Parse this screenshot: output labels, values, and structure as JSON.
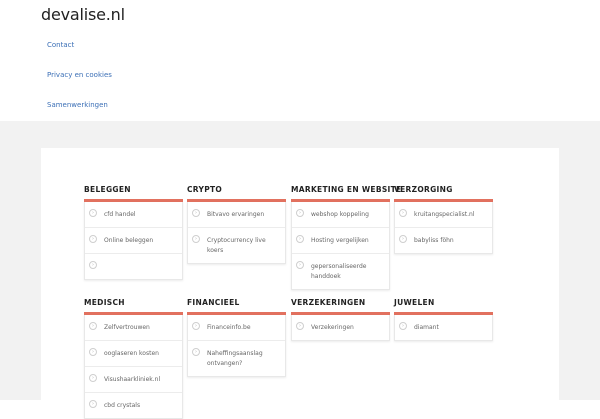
{
  "site": {
    "title": "devalise.nl"
  },
  "nav": {
    "items": [
      {
        "label": "Contact"
      },
      {
        "label": "Privacy en cookies"
      },
      {
        "label": "Samenwerkingen"
      }
    ]
  },
  "categories": [
    {
      "title": "BELEGGEN",
      "items": [
        "cfd handel",
        "Online beleggen",
        ""
      ]
    },
    {
      "title": "CRYPTO",
      "items": [
        "Bitvavo ervaringen",
        "Cryptocurrency live koers"
      ]
    },
    {
      "title": "MARKETING EN WEBSITE",
      "items": [
        "webshop koppeling",
        "Hosting vergelijken",
        "gepersonaliseerde handdoek"
      ]
    },
    {
      "title": "VERZORGING",
      "items": [
        "kruitangspecialist.nl",
        "babyliss föhn"
      ]
    },
    {
      "title": "MEDISCH",
      "items": [
        "Zelfvertrouwen",
        "ooglaseren kosten",
        "Visushaarkliniek.nl",
        "cbd crystals"
      ]
    },
    {
      "title": "FINANCIEEL",
      "items": [
        "Financeinfo.be",
        "Naheffingsaanslag ontvangen?"
      ]
    },
    {
      "title": "VERZEKERINGEN",
      "items": [
        "Verzekeringen"
      ]
    },
    {
      "title": "JUWELEN",
      "items": [
        "diamant"
      ]
    }
  ],
  "colors": {
    "accent_bar": "#e2715f",
    "link": "#3b6fb6",
    "page_bg": "#f2f2f2"
  },
  "icons": {
    "list_bullet": "circle-arrow-icon"
  }
}
